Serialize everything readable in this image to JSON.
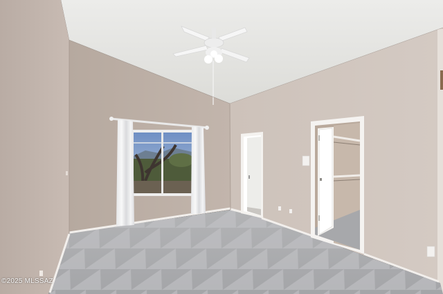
{
  "photo": {
    "watermark": "©2025 MLSSAZ"
  }
}
